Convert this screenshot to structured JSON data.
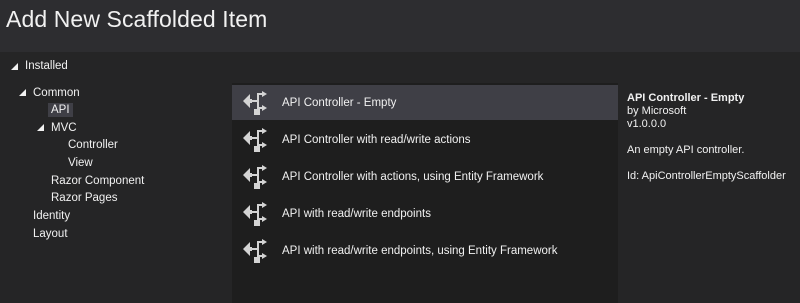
{
  "window": {
    "title": "Add New Scaffolded Item"
  },
  "tree": {
    "root_label": "Installed",
    "nodes": [
      {
        "label": "Common",
        "expanded": true
      },
      {
        "label": "API",
        "selected": true
      },
      {
        "label": "MVC",
        "expanded": true
      },
      {
        "label": "Controller"
      },
      {
        "label": "View"
      },
      {
        "label": "Razor Component"
      },
      {
        "label": "Razor Pages"
      },
      {
        "label": "Identity"
      },
      {
        "label": "Layout"
      }
    ]
  },
  "templates": [
    {
      "label": "API Controller - Empty",
      "icon": "api-controller-icon",
      "selected": true
    },
    {
      "label": "API Controller with read/write actions",
      "icon": "api-controller-icon"
    },
    {
      "label": "API Controller with actions, using Entity Framework",
      "icon": "api-controller-icon"
    },
    {
      "label": "API with read/write endpoints",
      "icon": "api-controller-icon"
    },
    {
      "label": "API with read/write endpoints, using Entity Framework",
      "icon": "api-controller-icon"
    }
  ],
  "details": {
    "title": "API Controller - Empty",
    "author": "by Microsoft",
    "version": "v1.0.0.0",
    "description": "An empty API controller.",
    "id": "Id: ApiControllerEmptyScaffolder"
  },
  "colors": {
    "background": "#252526",
    "title_bar": "#2d2d30",
    "list_background": "#1e1e1e",
    "selection": "#3f3f46",
    "text": "#f1f1f1"
  }
}
